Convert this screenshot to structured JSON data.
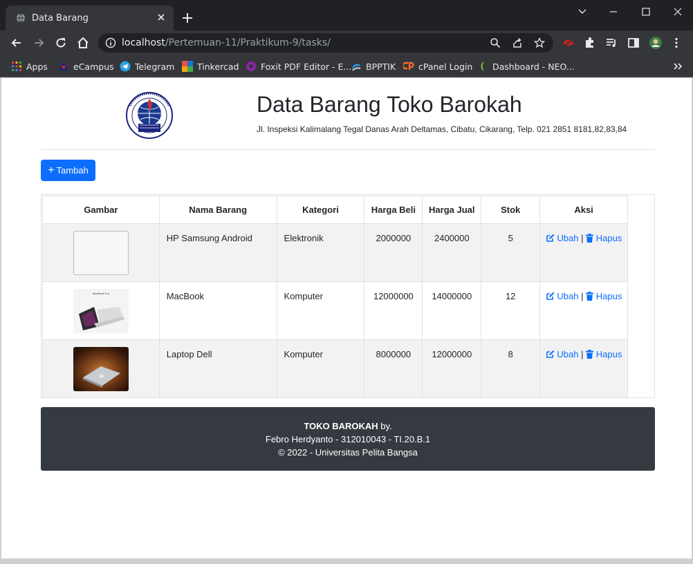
{
  "browser": {
    "tab_title": "Data Barang",
    "url_host": "localhost",
    "url_path": "/Pertemuan-11/Praktikum-9/tasks/",
    "bookmarks": [
      {
        "label": "Apps",
        "icon": "apps-grid-icon"
      },
      {
        "label": "eCampus",
        "icon": "ecampus-icon"
      },
      {
        "label": "Telegram",
        "icon": "telegram-icon"
      },
      {
        "label": "Tinkercad",
        "icon": "tinkercad-icon"
      },
      {
        "label": "Foxit PDF Editor - E...",
        "icon": "foxit-icon"
      },
      {
        "label": "BPPTIK",
        "icon": "bpptik-icon"
      },
      {
        "label": "cPanel Login",
        "icon": "cpanel-icon"
      },
      {
        "label": "Dashboard - NEO...",
        "icon": "neo-icon"
      }
    ]
  },
  "header": {
    "title": "Data Barang Toko Barokah",
    "address": "Jl. Inspeksi Kalimalang Tegal Danas Arah Deltamas, Cibatu, Cikarang, Telp. 021 2851 8181,82,83,84"
  },
  "add_button": "Tambah",
  "table": {
    "columns": [
      "Gambar",
      "Nama Barang",
      "Kategori",
      "Harga Beli",
      "Harga Jual",
      "Stok",
      "Aksi"
    ],
    "rows": [
      {
        "name": "HP Samsung Android",
        "category": "Elektronik",
        "buy": "2000000",
        "sell": "2400000",
        "stock": "5",
        "image": "broken"
      },
      {
        "name": "MacBook",
        "category": "Komputer",
        "buy": "12000000",
        "sell": "14000000",
        "stock": "12",
        "image": "macbook-pro"
      },
      {
        "name": "Laptop Dell",
        "category": "Komputer",
        "buy": "8000000",
        "sell": "12000000",
        "stock": "8",
        "image": "laptop-dell"
      }
    ],
    "edit_label": "Ubah",
    "separator": "|",
    "delete_label": "Hapus",
    "macbook_caption": "MacBook Pro"
  },
  "footer": {
    "brand": "TOKO BAROKAH",
    "brand_suffix": " by.",
    "author": "Febro Herdyanto - 312010043 - TI.20.B.1",
    "copyright": "© 2022 - Universitas Pelita Bangsa"
  },
  "colors": {
    "primary": "#0d6efd",
    "footer_bg": "#343a40",
    "chrome_dark": "#202124",
    "chrome_toolbar": "#35363a"
  }
}
